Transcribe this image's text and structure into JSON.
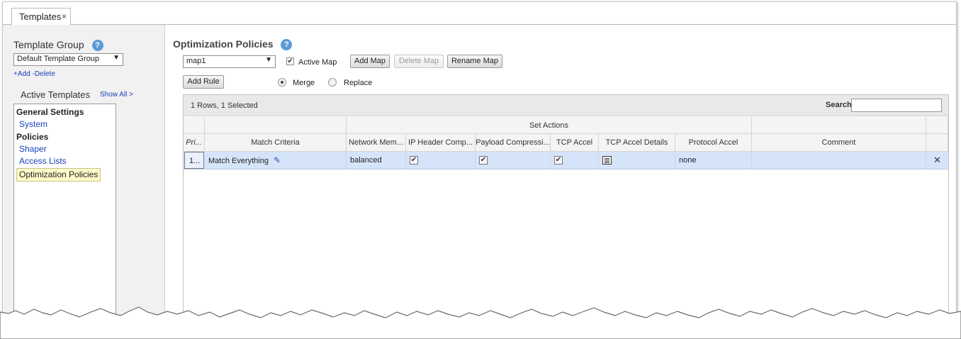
{
  "tab": {
    "label": "Templates",
    "close": "×"
  },
  "left": {
    "template_group_label": "Template Group",
    "help": "?",
    "template_group_value": "Default Template Group",
    "add_link": "+Add",
    "delete_link": "-Delete",
    "active_templates_label": "Active Templates",
    "show_all": "Show All >",
    "tree": {
      "group_general": "General Settings",
      "item_system": "System",
      "group_policies": "Policies",
      "item_shaper": "Shaper",
      "item_access_lists": "Access Lists",
      "item_optimization": "Optimization Policies"
    }
  },
  "main": {
    "title": "Optimization Policies",
    "help": "?",
    "map_value": "map1",
    "active_map_label": "Active Map",
    "active_map_checked": true,
    "add_map": "Add Map",
    "delete_map": "Delete Map",
    "rename_map": "Rename Map",
    "add_rule": "Add Rule",
    "merge_label": "Merge",
    "replace_label": "Replace",
    "selected_mode": "Merge"
  },
  "grid": {
    "rows_info": "1 Rows, 1 Selected",
    "search_label": "Search",
    "search_value": "",
    "group_header": "Set Actions",
    "columns": {
      "priority": "Pri...",
      "match": "Match Criteria",
      "network_memory": "Network Mem...",
      "ip_header": "IP Header Comp...",
      "payload": "Payload Compressi...",
      "tcp_accel": "TCP Accel",
      "tcp_details": "TCP Accel Details",
      "protocol_accel": "Protocol Accel",
      "comment": "Comment"
    },
    "row": {
      "priority": "1...",
      "match": "Match Everything",
      "network_memory": "balanced",
      "ip_header_checked": true,
      "payload_checked": true,
      "tcp_accel_checked": true,
      "protocol_accel": "none",
      "comment": "",
      "delete": "✕"
    }
  },
  "colors": {
    "accent": "#5b9bd5",
    "link": "#1a3fbf",
    "selected_row": "#d6e4fa",
    "selected_tree": "#fdfbc8"
  }
}
